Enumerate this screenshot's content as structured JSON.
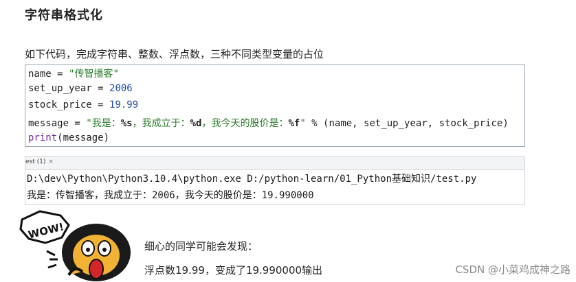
{
  "title": "字符串格式化",
  "intro": "如下代码，完成字符串、整数、浮点数，三种不同类型变量的占位",
  "code": {
    "line1": {
      "var": "name = ",
      "str": "\"传智播客\""
    },
    "line2": {
      "var": "set_up_year = ",
      "num": "2006"
    },
    "line3": {
      "var": "stock_price = ",
      "num": "19.99"
    },
    "line4": {
      "var": "message = ",
      "s1": "\"我是：",
      "f1": "%s",
      "s2": "，我成立于：",
      "f2": "%d",
      "s3": "，我今天的股价是：",
      "f3": "%f",
      "s4": "\"",
      "rest": " % (name, set_up_year, stock_price)"
    },
    "line5": {
      "fn": "print",
      "rest": "(message)"
    }
  },
  "run_tab": {
    "label": "est (1)",
    "close": "×"
  },
  "console": {
    "cmd": "D:\\dev\\Python\\Python3.10.4\\python.exe D:/python-learn/01_Python基础知识/test.py",
    "output": "我是：传智播客，我成立于：2006，我今天的股价是：19.990000"
  },
  "mascot": {
    "exclaim": "WOW!"
  },
  "notes": {
    "line1": "细心的同学可能会发现：",
    "line2": "浮点数19.99，变成了19.990000输出"
  },
  "watermark": "CSDN @小菜鸡成神之路"
}
